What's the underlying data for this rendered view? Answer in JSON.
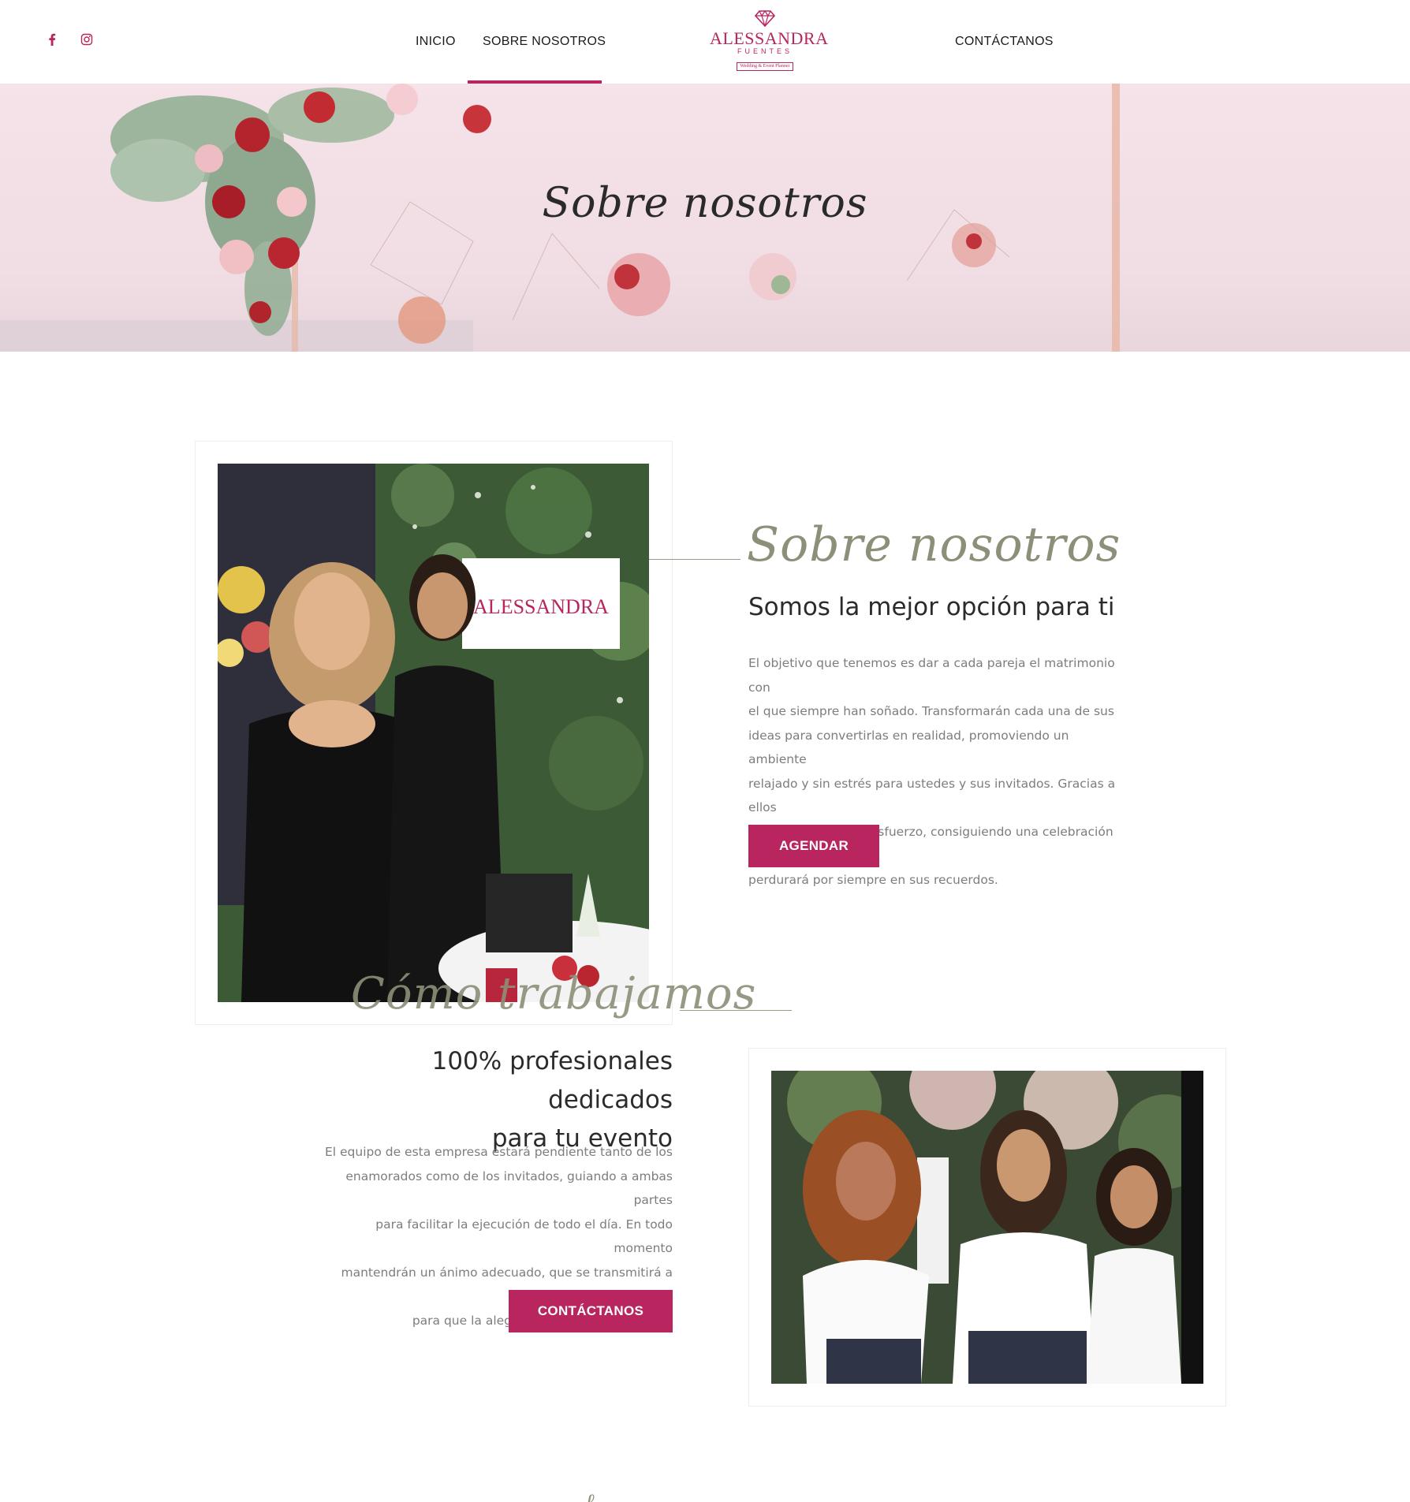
{
  "header": {
    "social": [
      {
        "icon": "facebook-icon"
      },
      {
        "icon": "instagram-icon"
      }
    ],
    "nav": {
      "inicio": "INICIO",
      "sobre": "SOBRE NOSOTROS",
      "contacto": "CONTÁCTANOS"
    },
    "logo": {
      "main": "ALESSANDRA",
      "sub": "FUENTES",
      "tag": "Wedding & Event Planner"
    },
    "accent_color": "#b8255f"
  },
  "hero": {
    "title": "Sobre nosotros"
  },
  "about": {
    "script": "Sobre nosotros",
    "heading": "Somos la mejor opción para ti",
    "lines": [
      "El objetivo que tenemos es dar a cada pareja el matrimonio con",
      "el que siempre han soñado. Transformarán cada una de sus",
      "ideas para convertirlas en realidad, promoviendo un ambiente",
      "relajado y sin estrés para ustedes y sus invitados. Gracias a ellos",
      "ahorrarán tiempo y esfuerzo, consiguiendo una celebración que",
      "perdurará por siempre en sus recuerdos."
    ],
    "button": "AGENDAR"
  },
  "work": {
    "script": "Cómo trabajamos",
    "heading_lines": [
      "100% profesionales dedicados",
      "para tu evento"
    ],
    "lines": [
      "El equipo de esta empresa estará pendiente tanto de los",
      "enamorados como de los invitados, guiando a ambas partes",
      "para facilitar la ejecución de todo el día. En todo momento",
      "mantendrán un ánimo adecuado, que se transmitirá a todos",
      "para que la alegría esté siempre presente."
    ],
    "button": "CONTÁCTANOS"
  }
}
